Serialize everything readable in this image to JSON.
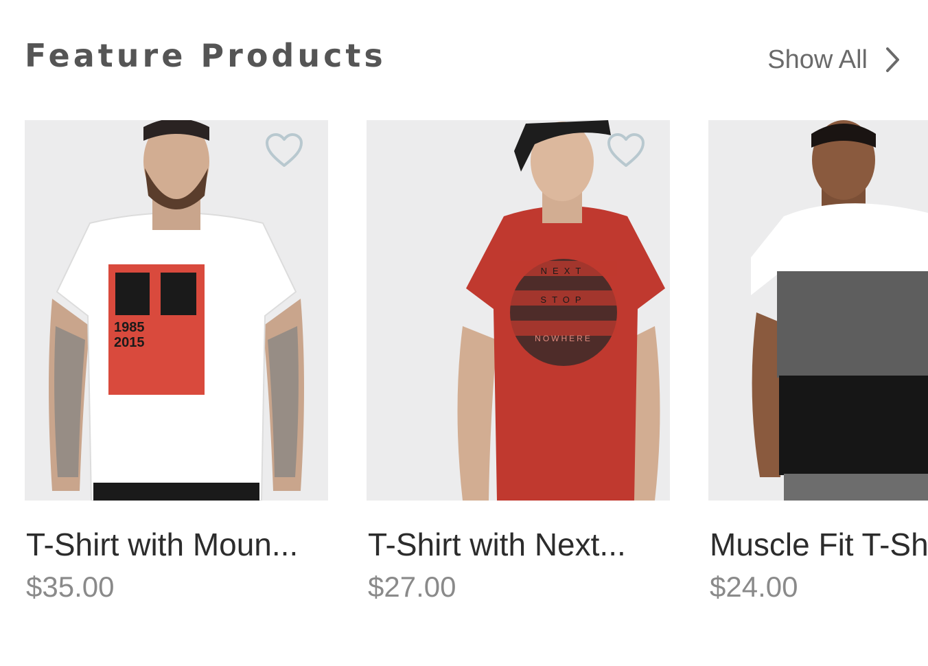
{
  "section": {
    "title": "Feature Products",
    "show_all_label": "Show All"
  },
  "products": [
    {
      "name": "T-Shirt with Moun...",
      "price": "$35.00",
      "shirt_color": "#ffffff",
      "print_text_1": "1985",
      "print_text_2": "2015"
    },
    {
      "name": "T-Shirt with Next...",
      "price": "$27.00",
      "shirt_color": "#c0392f",
      "print_text_1": "NEXT",
      "print_text_2": "STOP",
      "print_text_3": "NOWHERE"
    },
    {
      "name": "Muscle Fit T-Shirt",
      "price": "$24.00"
    }
  ],
  "colors": {
    "title": "#555555",
    "price": "#8a8a8a",
    "heart_outline": "#b8c8cf",
    "image_bg": "#ececed"
  }
}
